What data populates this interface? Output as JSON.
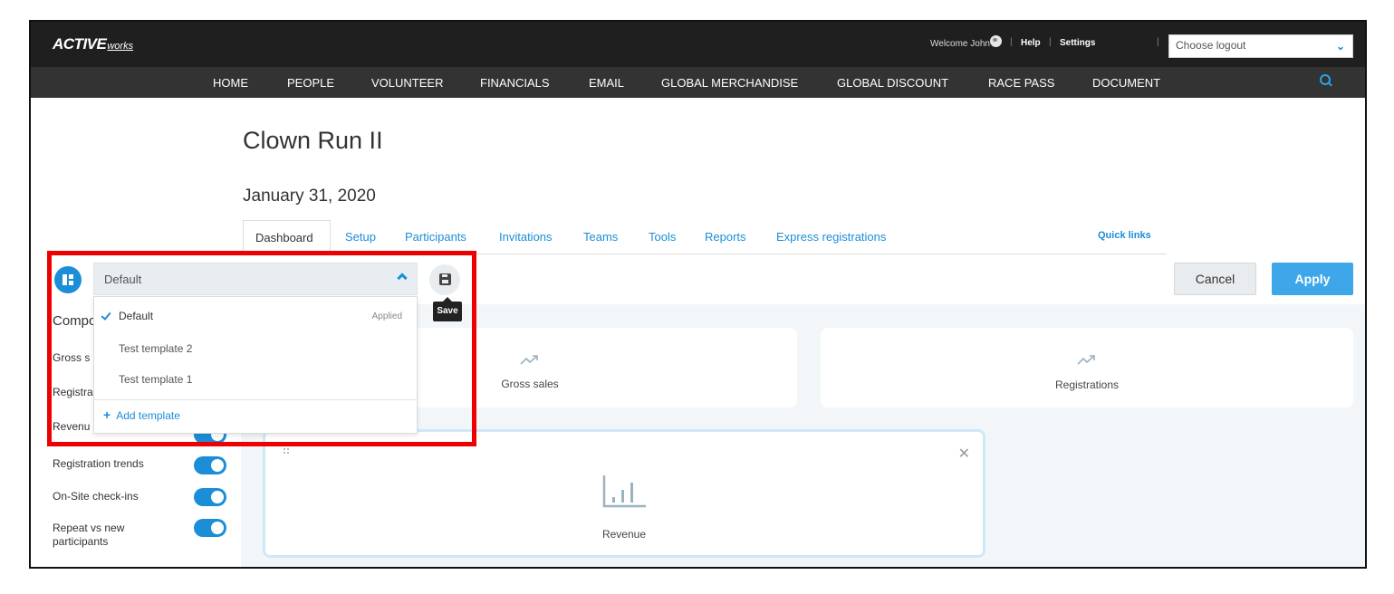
{
  "brand": {
    "logo_main": "ACTIVE",
    "logo_sub": "works"
  },
  "topbar": {
    "welcome": "Welcome John",
    "help": "Help",
    "settings": "Settings",
    "logout_placeholder": "Choose logout"
  },
  "nav": {
    "items": [
      "HOME",
      "PEOPLE",
      "VOLUNTEER",
      "FINANCIALS",
      "EMAIL",
      "GLOBAL MERCHANDISE",
      "GLOBAL DISCOUNT",
      "RACE PASS",
      "DOCUMENT"
    ]
  },
  "event": {
    "title": "Clown Run II",
    "date": "January 31, 2020"
  },
  "tabs": {
    "items": [
      "Dashboard",
      "Setup",
      "Participants",
      "Invitations",
      "Teams",
      "Tools",
      "Reports",
      "Express registrations"
    ],
    "active": "Dashboard",
    "quick_links": "Quick links"
  },
  "template_select": {
    "value": "Default",
    "options": [
      {
        "label": "Default",
        "selected": true,
        "status": "Applied"
      },
      {
        "label": "Test template 2"
      },
      {
        "label": "Test template 1"
      }
    ],
    "add_label": "Add template",
    "save_tooltip": "Save"
  },
  "actions": {
    "cancel": "Cancel",
    "apply": "Apply"
  },
  "sidebar": {
    "heading": "Compo",
    "items": [
      {
        "label": "Gross s",
        "enabled": true
      },
      {
        "label": "Registra",
        "enabled": true
      },
      {
        "label": "Revenu",
        "enabled": true
      },
      {
        "label": "Registration trends",
        "enabled": true
      },
      {
        "label": "On-Site check-ins",
        "enabled": true
      },
      {
        "label": "Repeat vs new participants",
        "enabled": true
      }
    ]
  },
  "widgets": {
    "gross_sales": "Gross sales",
    "registrations": "Registrations",
    "revenue": "Revenue"
  },
  "colors": {
    "accent": "#1b8ed7",
    "apply": "#3ea7ea",
    "highlight": "#ee0000",
    "nav_dark": "#1f1f1f",
    "nav_mid": "#333333"
  }
}
